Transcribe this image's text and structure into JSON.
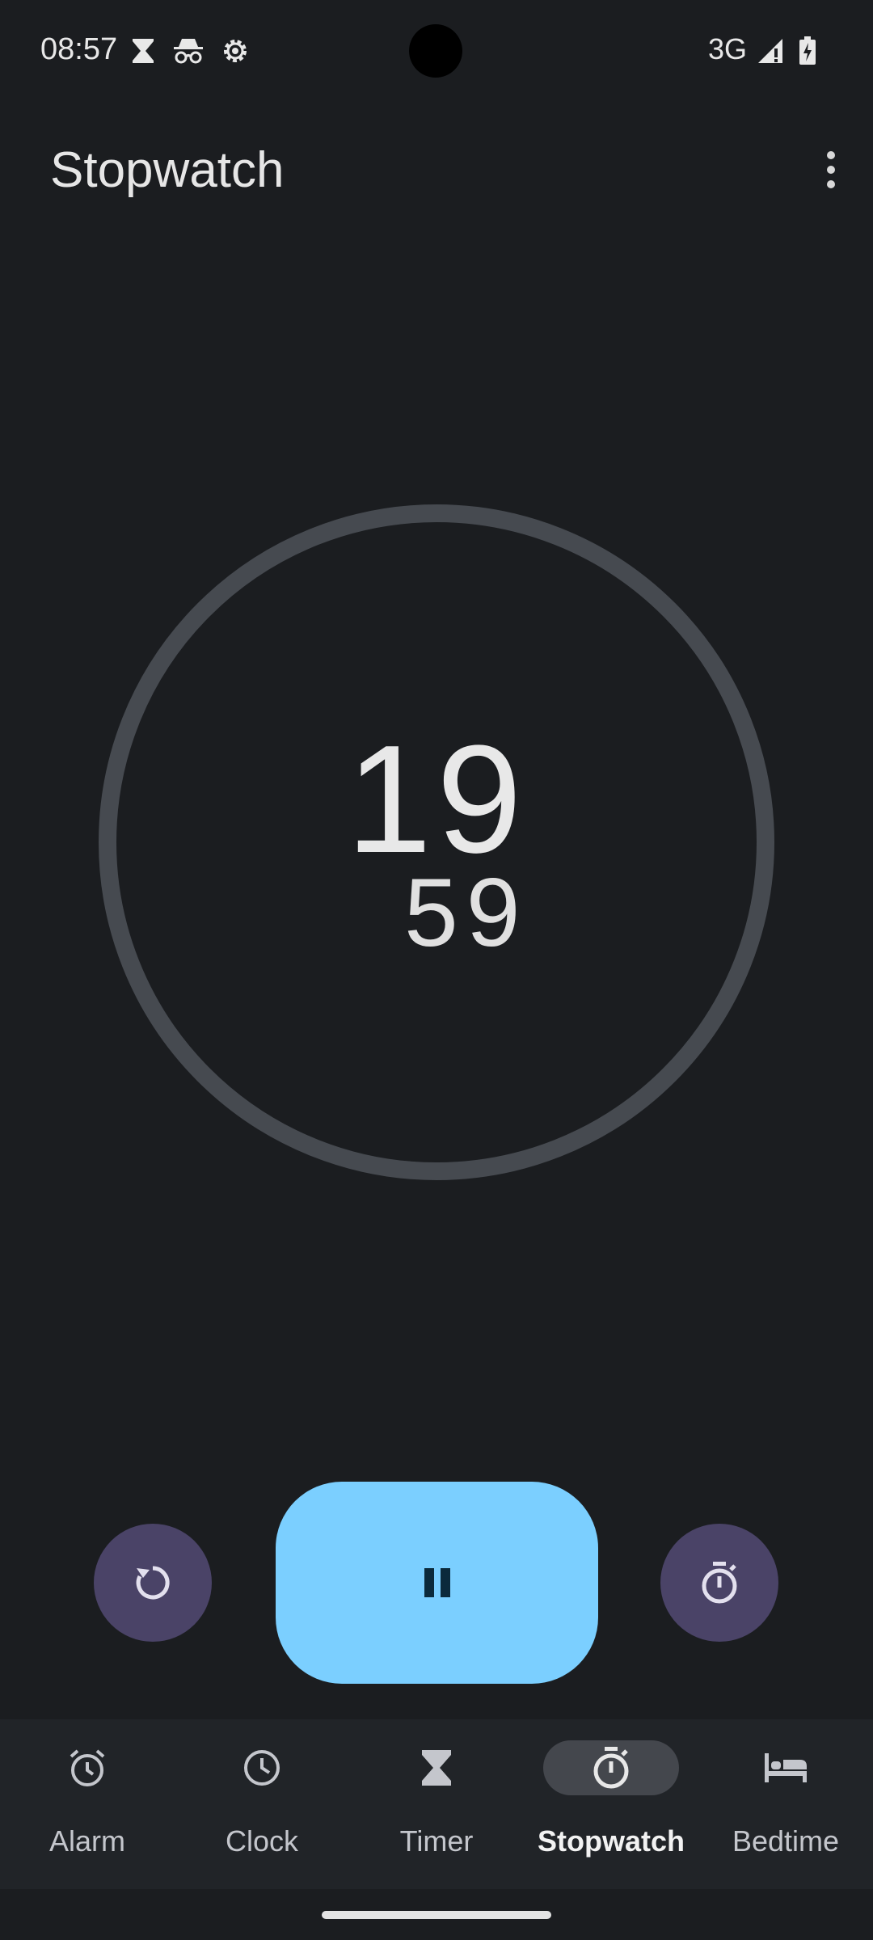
{
  "status_bar": {
    "time": "08:57",
    "icons": [
      "hourglass-icon",
      "incognito-icon",
      "settings-gear-icon"
    ],
    "network": "3G",
    "right_icons": [
      "signal-icon",
      "battery-charging-icon"
    ]
  },
  "app_bar": {
    "title": "Stopwatch",
    "overflow_icon": "more-vert-icon"
  },
  "stopwatch": {
    "seconds": "19",
    "hundredths": "59"
  },
  "controls": {
    "reset_icon": "reset-icon",
    "pause_icon": "pause-icon",
    "lap_icon": "lap-timer-icon"
  },
  "bottom_nav": {
    "items": [
      {
        "label": "Alarm",
        "icon": "alarm-icon",
        "active": false
      },
      {
        "label": "Clock",
        "icon": "clock-icon",
        "active": false
      },
      {
        "label": "Timer",
        "icon": "hourglass-icon",
        "active": false
      },
      {
        "label": "Stopwatch",
        "icon": "stopwatch-icon",
        "active": true
      },
      {
        "label": "Bedtime",
        "icon": "bed-icon",
        "active": false
      }
    ]
  },
  "colors": {
    "background": "#1b1d20",
    "accent": "#7bcfff",
    "secondary_button": "#4a4367",
    "ring": "#464a50"
  }
}
